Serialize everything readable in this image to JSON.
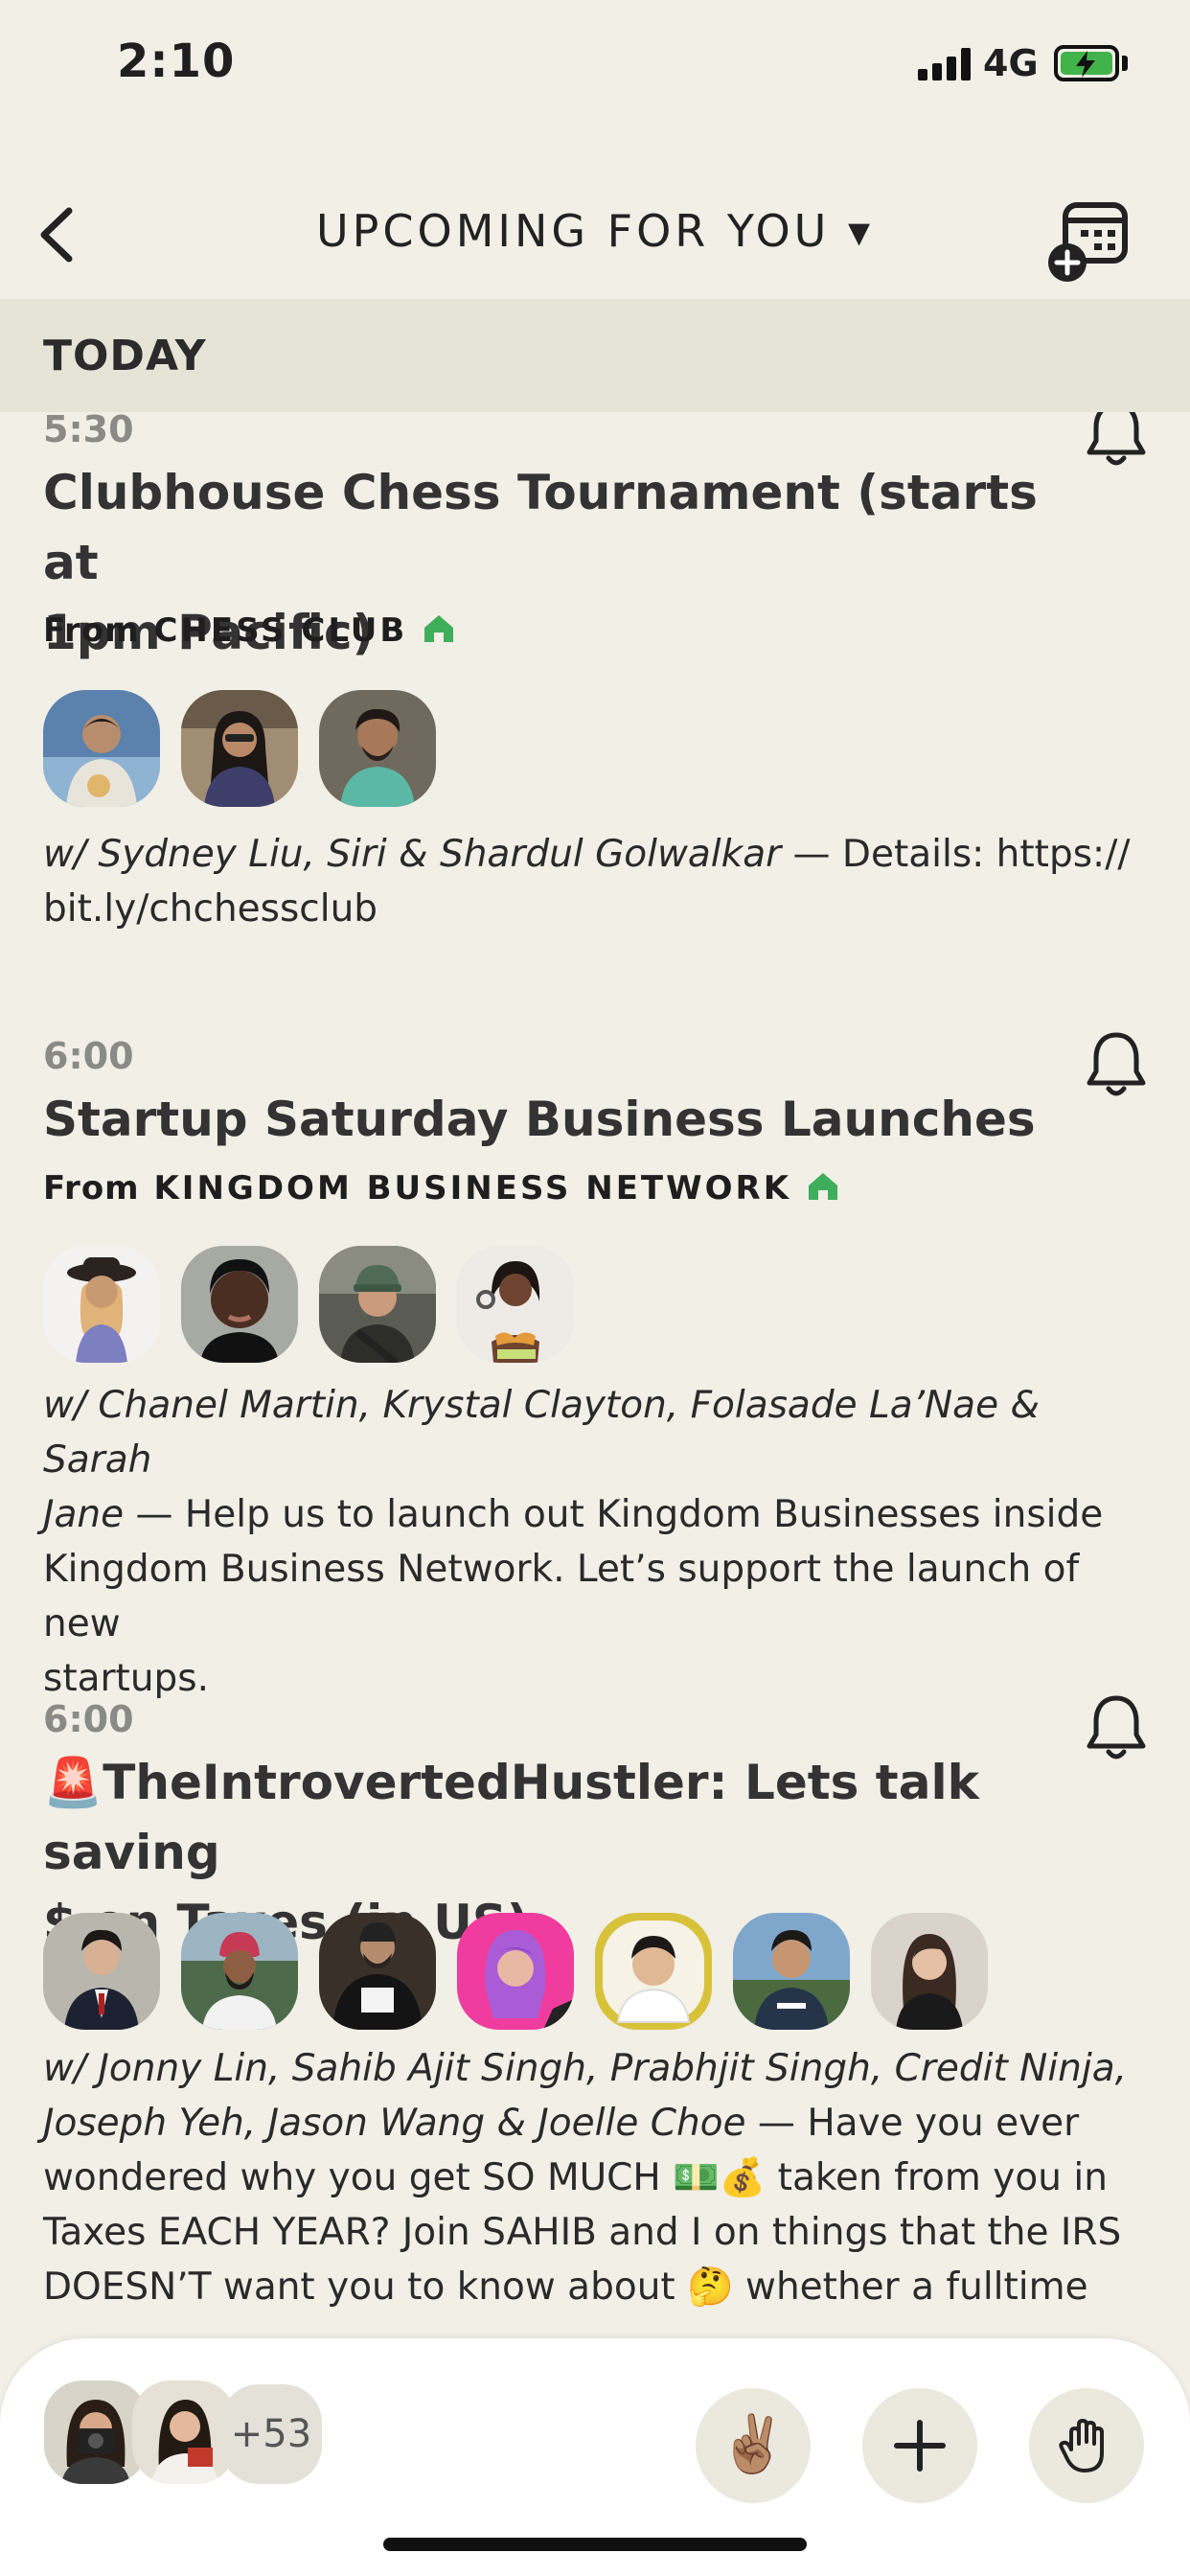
{
  "status": {
    "time": "2:10",
    "network": "4G"
  },
  "nav": {
    "title": "UPCOMING FOR YOU ▾"
  },
  "section": {
    "label": "TODAY"
  },
  "events": [
    {
      "time": "5:30",
      "title_line1": "Clubhouse Chess Tournament (starts at",
      "title_line2": "1pm Pacific)",
      "from_label": "From",
      "club": "CHESS CLUB",
      "names": "w/ Sydney Liu, Siri & Shardul Golwalkar",
      "desc_line1_rest": " — Details: https://",
      "desc_line2": "bit.ly/chchessclub"
    },
    {
      "time": "6:00",
      "title_line1": "Startup Saturday Business Launches",
      "from_label": "From",
      "club": "KINGDOM BUSINESS NETWORK",
      "names_line1": "w/ Chanel Martin, Krystal Clayton, Folasade La’Nae & Sarah",
      "names_line2": "Jane",
      "desc_line2_rest": " — Help us to launch out Kingdom Businesses inside",
      "desc_line3": "Kingdom Business Network. Let’s support the launch of new",
      "desc_line4": "startups."
    },
    {
      "time": "6:00",
      "title_line1": "🚨TheIntrovertedHustler: Lets talk saving",
      "title_line2": "$ on Taxes (in US)",
      "names_line1": "w/ Jonny Lin, Sahib Ajit Singh, Prabhjit Singh, Credit Ninja,",
      "names_line2": "Joseph Yeh, Jason Wang & Joelle Choe",
      "desc_line2_rest": " — Have you ever",
      "desc_line3": "wondered why you get SO MUCH 💵💰 taken from you in",
      "desc_line4": "Taxes EACH YEAR? Join SAHIB and I on things that the IRS",
      "desc_line5": "DOESN’T want you to know about 🤔 whether a fulltime"
    }
  ],
  "bottom": {
    "more_count": "+53",
    "peace_emoji": "✌🏽"
  },
  "colors": {
    "background": "#f1efe6",
    "section_bar": "#e6e3d7",
    "club_home": "#3fae5a",
    "button_bg": "#ebe8de"
  },
  "icons": [
    "back-chevron-icon",
    "calendar-add-icon",
    "bell-icon",
    "home-icon",
    "plus-icon",
    "raised-hand-icon"
  ]
}
